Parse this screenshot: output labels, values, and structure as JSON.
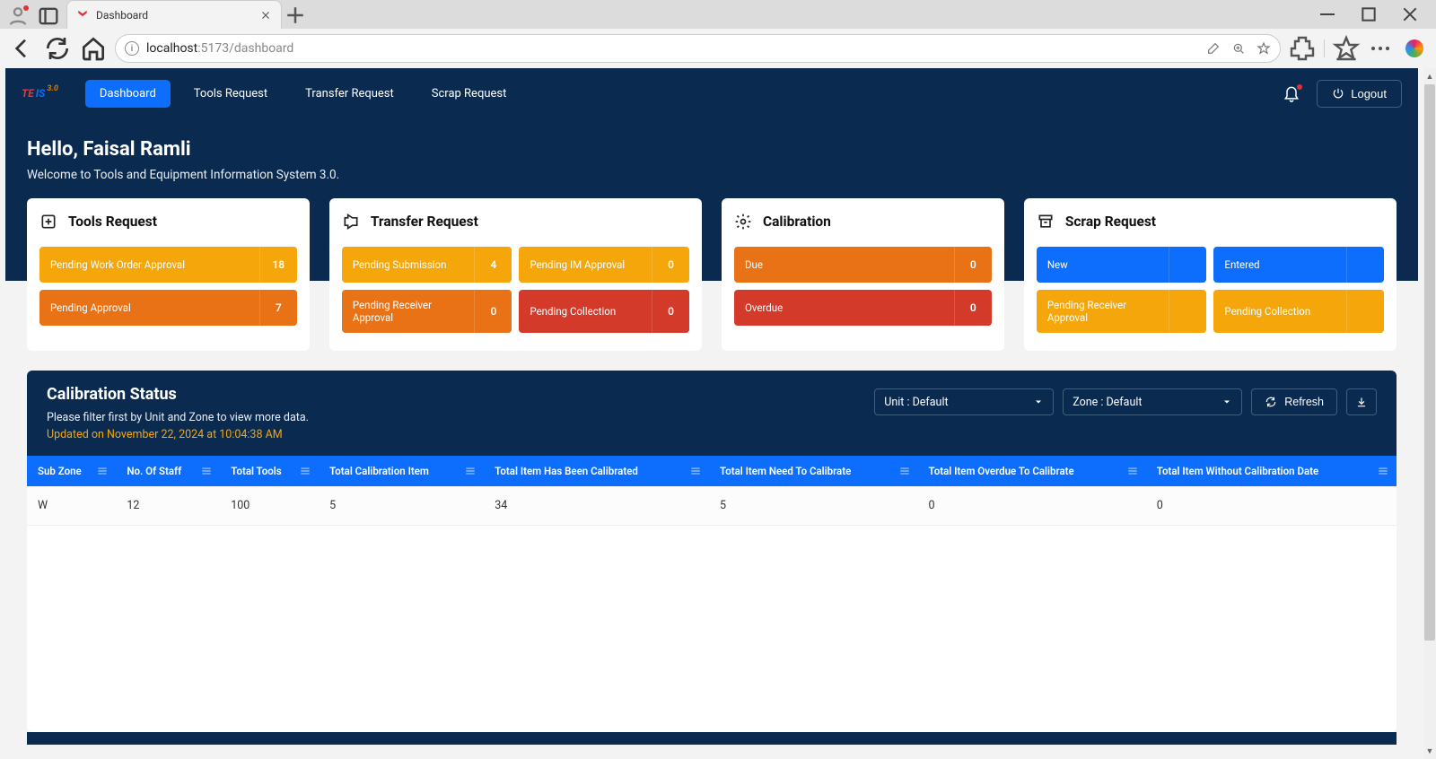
{
  "browser": {
    "tab_title": "Dashboard",
    "url_host": "localhost",
    "url_port_path": ":5173/dashboard"
  },
  "header": {
    "logo_pre": "TE",
    "logo_suf": "IS",
    "logo_ver": "3.0",
    "nav": [
      "Dashboard",
      "Tools Request",
      "Transfer Request",
      "Scrap Request"
    ],
    "logout": "Logout"
  },
  "hero": {
    "greeting": "Hello, Faisal Ramli",
    "subtitle": "Welcome to Tools and Equipment Information System 3.0."
  },
  "cards": {
    "tools": {
      "title": "Tools Request",
      "stats": [
        {
          "label": "Pending Work Order Approval",
          "value": "18",
          "color": "c-orange"
        },
        {
          "label": "Pending Approval",
          "value": "7",
          "color": "c-darkorange"
        }
      ]
    },
    "transfer": {
      "title": "Transfer Request",
      "stats": [
        {
          "label": "Pending Submission",
          "value": "4",
          "color": "c-orange"
        },
        {
          "label": "Pending IM Approval",
          "value": "0",
          "color": "c-orange"
        },
        {
          "label": "Pending Receiver Approval",
          "value": "0",
          "color": "c-darkorange"
        },
        {
          "label": "Pending Collection",
          "value": "0",
          "color": "c-red"
        }
      ]
    },
    "calibration": {
      "title": "Calibration",
      "stats": [
        {
          "label": "Due",
          "value": "0",
          "color": "c-darkorange"
        },
        {
          "label": "Overdue",
          "value": "0",
          "color": "c-red"
        }
      ]
    },
    "scrap": {
      "title": "Scrap Request",
      "stats": [
        {
          "label": "New",
          "value": "",
          "color": "c-blue"
        },
        {
          "label": "Entered",
          "value": "",
          "color": "c-blue"
        },
        {
          "label": "Pending Receiver Approval",
          "value": "",
          "color": "c-orange"
        },
        {
          "label": "Pending Collection",
          "value": "",
          "color": "c-orange"
        }
      ]
    }
  },
  "panel": {
    "title": "Calibration Status",
    "subtitle": "Please filter first by Unit and Zone to view more data.",
    "updated": "Updated on November 22, 2024 at 10:04:38 AM",
    "unit_select": "Unit : Default",
    "zone_select": "Zone : Default",
    "refresh": "Refresh"
  },
  "table": {
    "headers": [
      "Sub Zone",
      "No. Of Staff",
      "Total Tools",
      "Total Calibration Item",
      "Total Item Has Been Calibrated",
      "Total Item Need To Calibrate",
      "Total Item Overdue To Calibrate",
      "Total Item Without Calibration Date"
    ],
    "rows": [
      [
        "W",
        "12",
        "100",
        "5",
        "34",
        "5",
        "0",
        "0"
      ]
    ]
  }
}
